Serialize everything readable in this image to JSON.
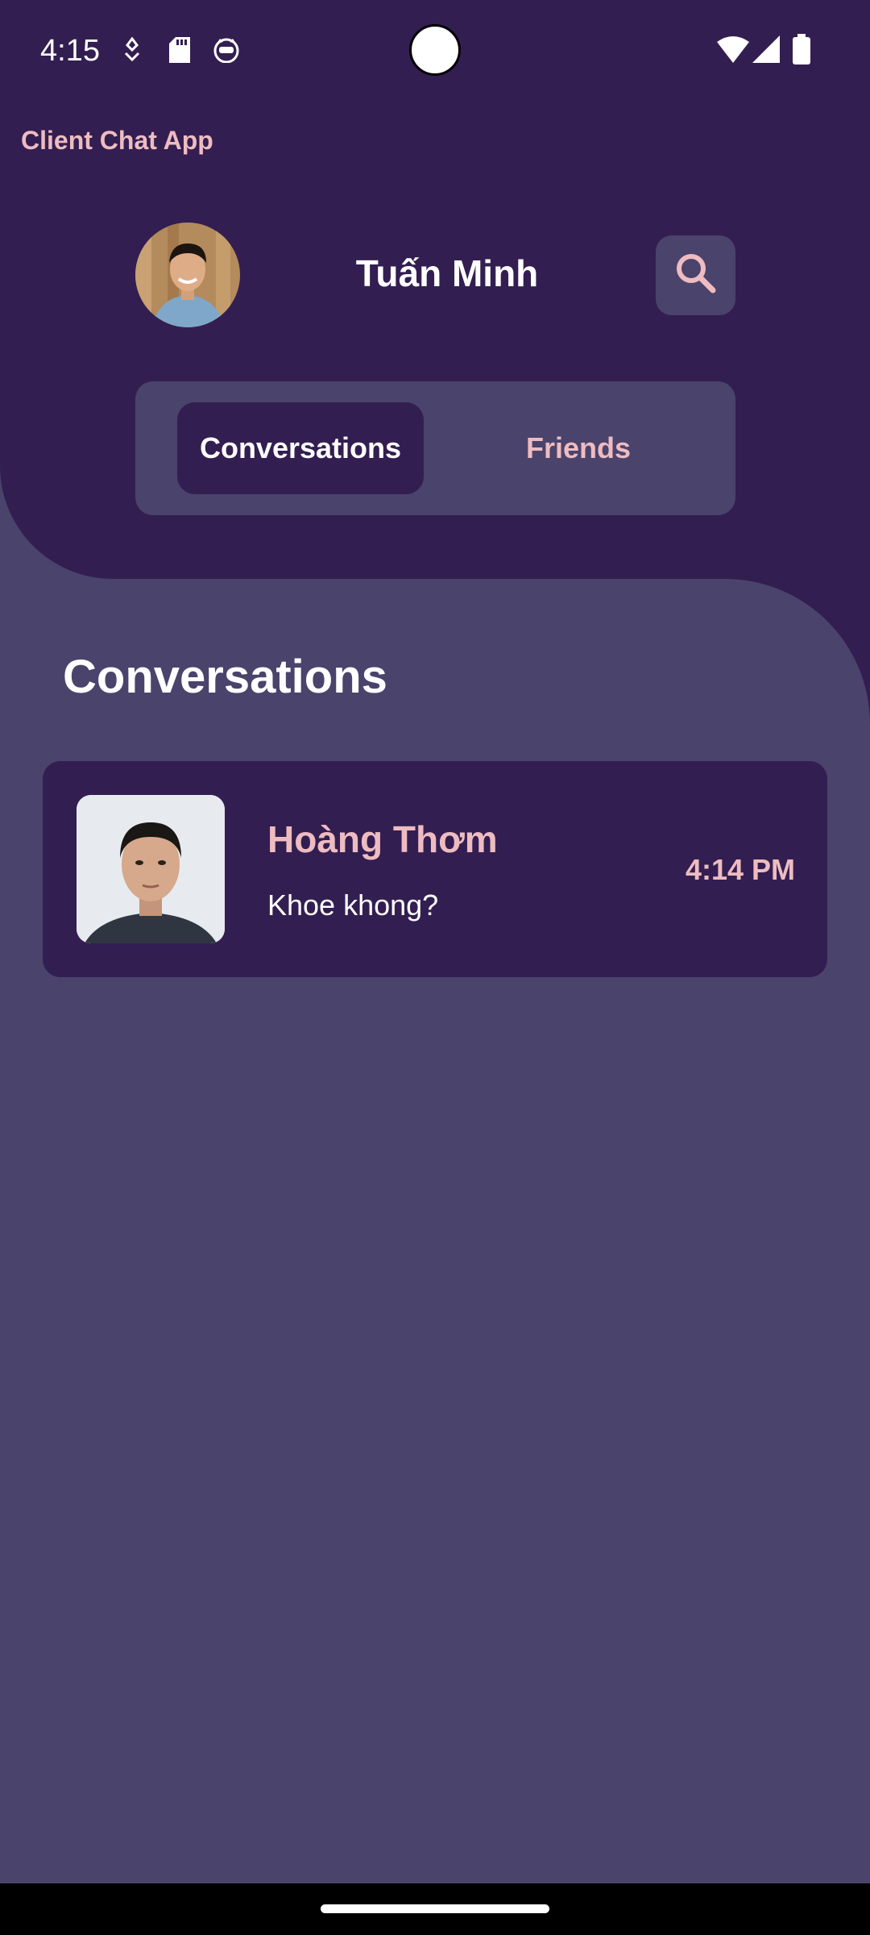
{
  "status_bar": {
    "time": "4:15",
    "icons_left": [
      "location-pin-icon",
      "sd-card-icon",
      "cat-face-icon"
    ],
    "icons_right": [
      "wifi-icon",
      "cell-signal-icon",
      "battery-icon"
    ]
  },
  "app": {
    "title": "Client Chat App"
  },
  "profile": {
    "name": "Tuấn Minh",
    "avatar_icon": "user-avatar",
    "search_icon": "search-icon"
  },
  "tabs": [
    {
      "label": "Conversations",
      "active": true
    },
    {
      "label": "Friends",
      "active": false
    }
  ],
  "section": {
    "title": "Conversations"
  },
  "conversations": [
    {
      "name": "Hoàng Thơm",
      "message": "Khoe khong?",
      "time": "4:14 PM"
    }
  ],
  "colors": {
    "header_bg": "#331e51",
    "body_bg": "#4a436c",
    "accent_pink": "#eebcc0",
    "white": "#ffffff"
  }
}
